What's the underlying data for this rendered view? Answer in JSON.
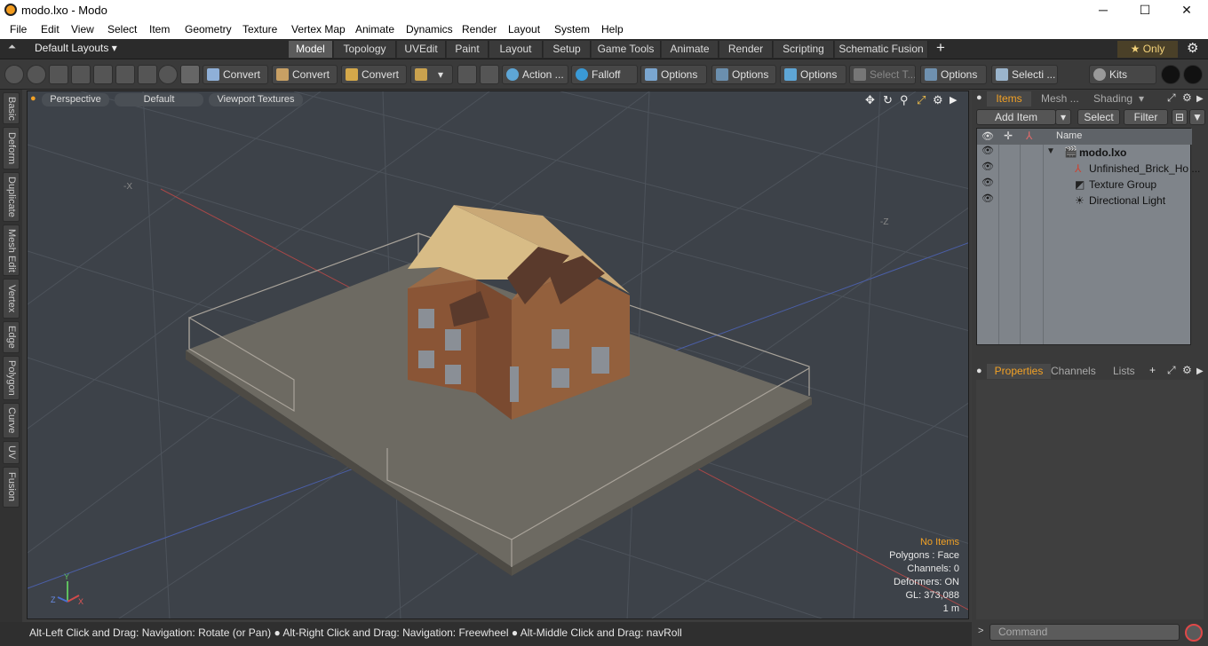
{
  "window": {
    "title": "modo.lxo - Modo",
    "minimize": "─",
    "maximize": "☐",
    "close": "✕"
  },
  "menu": [
    "File",
    "Edit",
    "View",
    "Select",
    "Item",
    "Geometry",
    "Texture",
    "Vertex Map",
    "Animate",
    "Dynamics",
    "Render",
    "Layout",
    "System",
    "Help"
  ],
  "layouts": {
    "selector": "Default Layouts ▾",
    "tabs": [
      "Model",
      "Topology",
      "UVEdit",
      "Paint",
      "Layout",
      "Setup",
      "Game Tools",
      "Animate",
      "Render",
      "Scripting",
      "Schematic Fusion"
    ],
    "active": "Model",
    "add": "+",
    "only": "★  Only",
    "gear": "⚙"
  },
  "toolbar": {
    "convert1": "Convert",
    "convert2": "Convert",
    "convert3": "Convert",
    "action": "Action ...",
    "falloff": "Falloff",
    "options1": "Options",
    "options2": "Options",
    "options3": "Options",
    "select_t": "Select T...",
    "options4": "Options",
    "selecti": "Selecti ...",
    "kits": "Kits"
  },
  "left_tabs": [
    "Basic",
    "Deform",
    "Duplicate",
    "Mesh Edit",
    "Vertex",
    "Edge",
    "Polygon",
    "Curve",
    "UV",
    "Fusion"
  ],
  "viewport": {
    "view": "Perspective",
    "shading": "Default",
    "textures": "Viewport Textures",
    "axis_x": "-X",
    "axis_z": "-Z",
    "info": {
      "items": "No Items",
      "polygons": "Polygons : Face",
      "channels": "Channels: 0",
      "deformers": "Deformers: ON",
      "gl": "GL: 373,088",
      "scale": "1 m"
    },
    "gizmo": {
      "y": "Y",
      "z": "Z",
      "x": "X"
    }
  },
  "status": "Alt-Left Click and Drag: Navigation: Rotate (or Pan) ● Alt-Right Click and Drag: Navigation: Freewheel ● Alt-Middle Click and Drag: navRoll",
  "items_panel": {
    "tabs": {
      "items": "Items",
      "mesh": "Mesh ...",
      "shading": "Shading"
    },
    "add_item": "Add Item",
    "select": "Select",
    "filter": "Filter",
    "col_name": "Name",
    "rows": [
      {
        "name": "modo.lxo",
        "kind": "scene"
      },
      {
        "name": "Unfinished_Brick_Ho ...",
        "kind": "mesh"
      },
      {
        "name": "Texture Group",
        "kind": "texture"
      },
      {
        "name": "Directional Light",
        "kind": "light"
      }
    ]
  },
  "properties_panel": {
    "tabs": {
      "properties": "Properties",
      "channels": "Channels",
      "lists": "Lists"
    },
    "add": "+"
  },
  "command": {
    "placeholder": "Command"
  },
  "colors": {
    "accent": "#f2a125",
    "viewport_bg": "#3d4249",
    "items_bg": "#7f848a"
  }
}
